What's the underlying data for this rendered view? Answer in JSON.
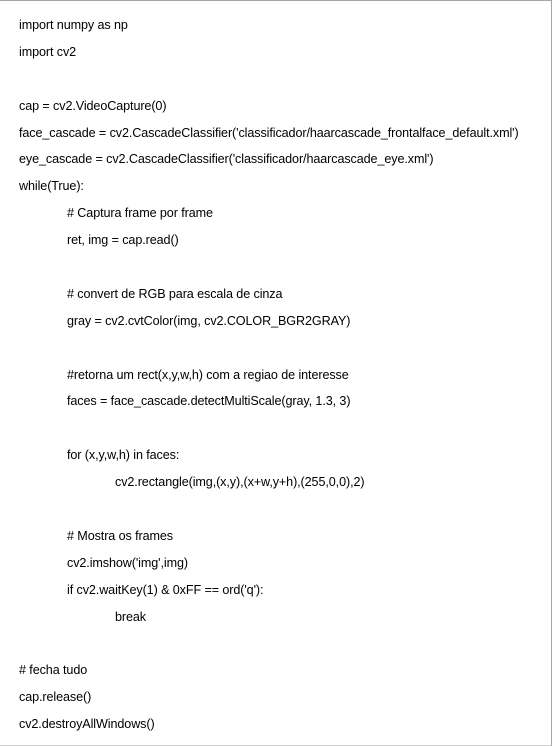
{
  "code": {
    "lines": [
      {
        "indent": 0,
        "text": "import numpy as np"
      },
      {
        "indent": 0,
        "text": "import cv2"
      },
      {
        "indent": 0,
        "text": ""
      },
      {
        "indent": 0,
        "text": "cap = cv2.VideoCapture(0)"
      },
      {
        "indent": 0,
        "text": "face_cascade = cv2.CascadeClassifier('classificador/haarcascade_frontalface_default.xml')"
      },
      {
        "indent": 0,
        "text": "eye_cascade = cv2.CascadeClassifier('classificador/haarcascade_eye.xml')"
      },
      {
        "indent": 0,
        "text": "while(True):"
      },
      {
        "indent": 1,
        "text": "# Captura frame por frame"
      },
      {
        "indent": 1,
        "text": "ret, img = cap.read()"
      },
      {
        "indent": 1,
        "text": ""
      },
      {
        "indent": 1,
        "text": "# convert de RGB para escala de cinza"
      },
      {
        "indent": 1,
        "text": "gray = cv2.cvtColor(img, cv2.COLOR_BGR2GRAY)"
      },
      {
        "indent": 1,
        "text": ""
      },
      {
        "indent": 1,
        "text": "#retorna um rect(x,y,w,h) com a regiao de interesse"
      },
      {
        "indent": 1,
        "text": "faces = face_cascade.detectMultiScale(gray, 1.3, 3)"
      },
      {
        "indent": 1,
        "text": ""
      },
      {
        "indent": 1,
        "text": "for (x,y,w,h) in faces:"
      },
      {
        "indent": 2,
        "text": "cv2.rectangle(img,(x,y),(x+w,y+h),(255,0,0),2)"
      },
      {
        "indent": 1,
        "text": ""
      },
      {
        "indent": 1,
        "text": "# Mostra os frames"
      },
      {
        "indent": 1,
        "text": "cv2.imshow('img',img)"
      },
      {
        "indent": 1,
        "text": "if cv2.waitKey(1) & 0xFF == ord('q'):"
      },
      {
        "indent": 2,
        "text": "break"
      },
      {
        "indent": 0,
        "text": ""
      },
      {
        "indent": 0,
        "text": "# fecha tudo"
      },
      {
        "indent": 0,
        "text": "cap.release()"
      },
      {
        "indent": 0,
        "text": "cv2.destroyAllWindows()"
      }
    ]
  }
}
